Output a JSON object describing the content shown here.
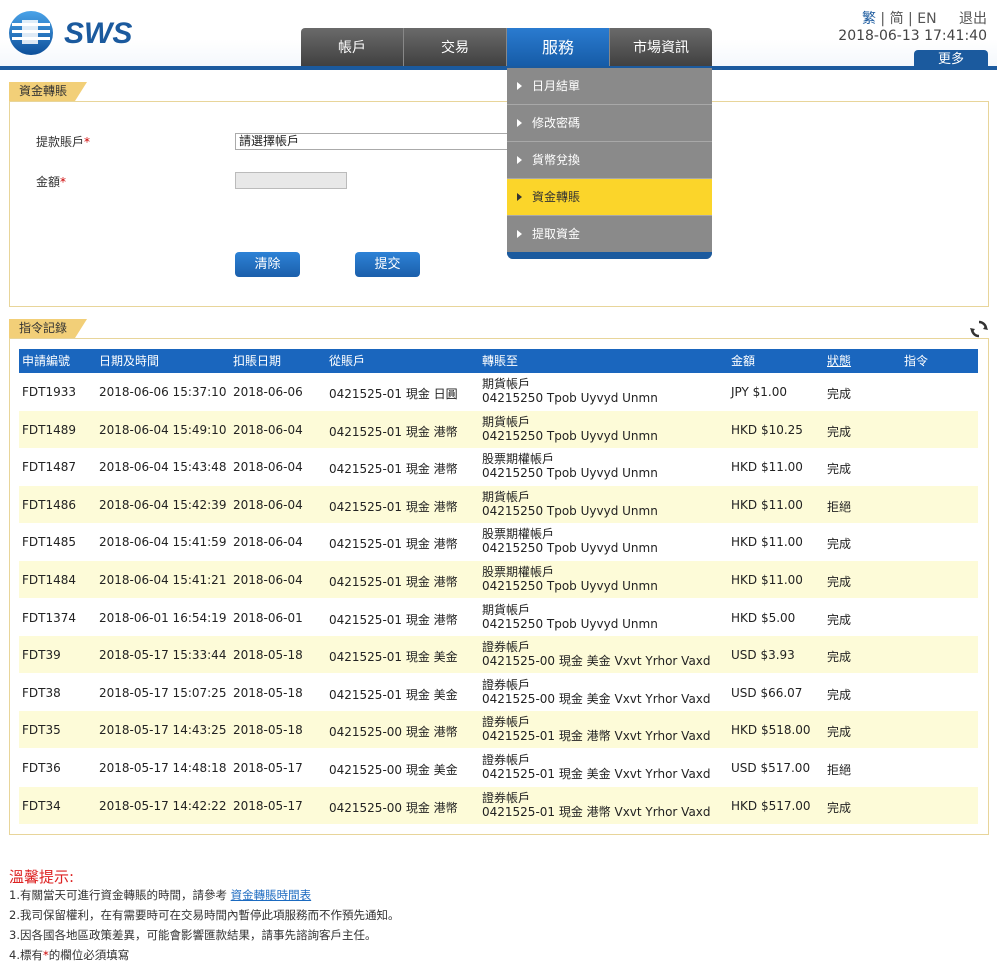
{
  "header": {
    "logo_text": "SWS",
    "nav": [
      "帳戶",
      "交易",
      "服務",
      "市場資訊"
    ],
    "lang_trad": "繁",
    "lang_simp": "简",
    "lang_en": "EN",
    "logout": "退出",
    "datetime": "2018-06-13 17:41:40",
    "more": "更多"
  },
  "dropdown": {
    "items": [
      "日月結單",
      "修改密碼",
      "貨幣兌換",
      "資金轉賬",
      "提取資金"
    ],
    "active_index": 3
  },
  "transfer_form": {
    "section_title": "資金轉賬",
    "account_label": "提款賬戶",
    "account_placeholder": "請選擇帳戶",
    "amount_label": "金額",
    "required_mark": "*",
    "clear_button": "清除",
    "submit_button": "提交"
  },
  "records": {
    "section_title": "指令記錄",
    "columns": [
      "申請編號",
      "日期及時間",
      "扣賬日期",
      "從賬戶",
      "轉賬至",
      "金額",
      "狀態",
      "指令"
    ],
    "rows": [
      {
        "id": "FDT1933",
        "datetime": "2018-06-06 15:37:10",
        "debit_date": "2018-06-06",
        "from": "0421525-01 現金 日圓",
        "to_type": "期貨帳戶",
        "to_account": "04215250 Tpob Uyvyd Unmn",
        "amount": "JPY $1.00",
        "status": "完成"
      },
      {
        "id": "FDT1489",
        "datetime": "2018-06-04 15:49:10",
        "debit_date": "2018-06-04",
        "from": "0421525-01 現金 港幣",
        "to_type": "期貨帳戶",
        "to_account": "04215250 Tpob Uyvyd Unmn",
        "amount": "HKD $10.25",
        "status": "完成"
      },
      {
        "id": "FDT1487",
        "datetime": "2018-06-04 15:43:48",
        "debit_date": "2018-06-04",
        "from": "0421525-01 現金 港幣",
        "to_type": "股票期權帳戶",
        "to_account": "04215250 Tpob Uyvyd Unmn",
        "amount": "HKD $11.00",
        "status": "完成"
      },
      {
        "id": "FDT1486",
        "datetime": "2018-06-04 15:42:39",
        "debit_date": "2018-06-04",
        "from": "0421525-01 現金 港幣",
        "to_type": "期貨帳戶",
        "to_account": "04215250 Tpob Uyvyd Unmn",
        "amount": "HKD $11.00",
        "status": "拒絕"
      },
      {
        "id": "FDT1485",
        "datetime": "2018-06-04 15:41:59",
        "debit_date": "2018-06-04",
        "from": "0421525-01 現金 港幣",
        "to_type": "股票期權帳戶",
        "to_account": "04215250 Tpob Uyvyd Unmn",
        "amount": "HKD $11.00",
        "status": "完成"
      },
      {
        "id": "FDT1484",
        "datetime": "2018-06-04 15:41:21",
        "debit_date": "2018-06-04",
        "from": "0421525-01 現金 港幣",
        "to_type": "股票期權帳戶",
        "to_account": "04215250 Tpob Uyvyd Unmn",
        "amount": "HKD $11.00",
        "status": "完成"
      },
      {
        "id": "FDT1374",
        "datetime": "2018-06-01 16:54:19",
        "debit_date": "2018-06-01",
        "from": "0421525-01 現金 港幣",
        "to_type": "期貨帳戶",
        "to_account": "04215250 Tpob Uyvyd Unmn",
        "amount": "HKD $5.00",
        "status": "完成"
      },
      {
        "id": "FDT39",
        "datetime": "2018-05-17 15:33:44",
        "debit_date": "2018-05-18",
        "from": "0421525-01 現金 美金",
        "to_type": "證券帳戶",
        "to_account": "0421525-00 現金 美金 Vxvt Yrhor Vaxd",
        "amount": "USD $3.93",
        "status": "完成"
      },
      {
        "id": "FDT38",
        "datetime": "2018-05-17 15:07:25",
        "debit_date": "2018-05-18",
        "from": "0421525-01 現金 美金",
        "to_type": "證券帳戶",
        "to_account": "0421525-00 現金 美金 Vxvt Yrhor Vaxd",
        "amount": "USD $66.07",
        "status": "完成"
      },
      {
        "id": "FDT35",
        "datetime": "2018-05-17 14:43:25",
        "debit_date": "2018-05-18",
        "from": "0421525-00 現金 港幣",
        "to_type": "證券帳戶",
        "to_account": "0421525-01 現金 港幣 Vxvt Yrhor Vaxd",
        "amount": "HKD $518.00",
        "status": "完成"
      },
      {
        "id": "FDT36",
        "datetime": "2018-05-17 14:48:18",
        "debit_date": "2018-05-17",
        "from": "0421525-00 現金 美金",
        "to_type": "證券帳戶",
        "to_account": "0421525-01 現金 美金 Vxvt Yrhor Vaxd",
        "amount": "USD $517.00",
        "status": "拒絕"
      },
      {
        "id": "FDT34",
        "datetime": "2018-05-17 14:42:22",
        "debit_date": "2018-05-17",
        "from": "0421525-00 現金 港幣",
        "to_type": "證券帳戶",
        "to_account": "0421525-01 現金 港幣 Vxvt Yrhor Vaxd",
        "amount": "HKD $517.00",
        "status": "完成"
      }
    ]
  },
  "notes": {
    "title": "溫馨提示:",
    "line1_prefix": "1.有關當天可進行資金轉賬的時間，請參考",
    "line1_link": "資金轉賬時間表",
    "line2": "2.我司保留權利，在有需要時可在交易時間內暫停此項服務而不作預先通知。",
    "line3": "3.因各國各地區政策差異，可能會影響匯款結果，請事先諮詢客戶主任。",
    "line4_prefix": "4.標有",
    "line4_mark": "*",
    "line4_suffix": "的欄位必須填寫"
  },
  "colors": {
    "brand_blue": "#1b5a9e",
    "menu_active": "#fbd52a",
    "section_tab": "#f2cf78",
    "row_alt": "#fdfbd8",
    "warning_red": "#d22222"
  }
}
